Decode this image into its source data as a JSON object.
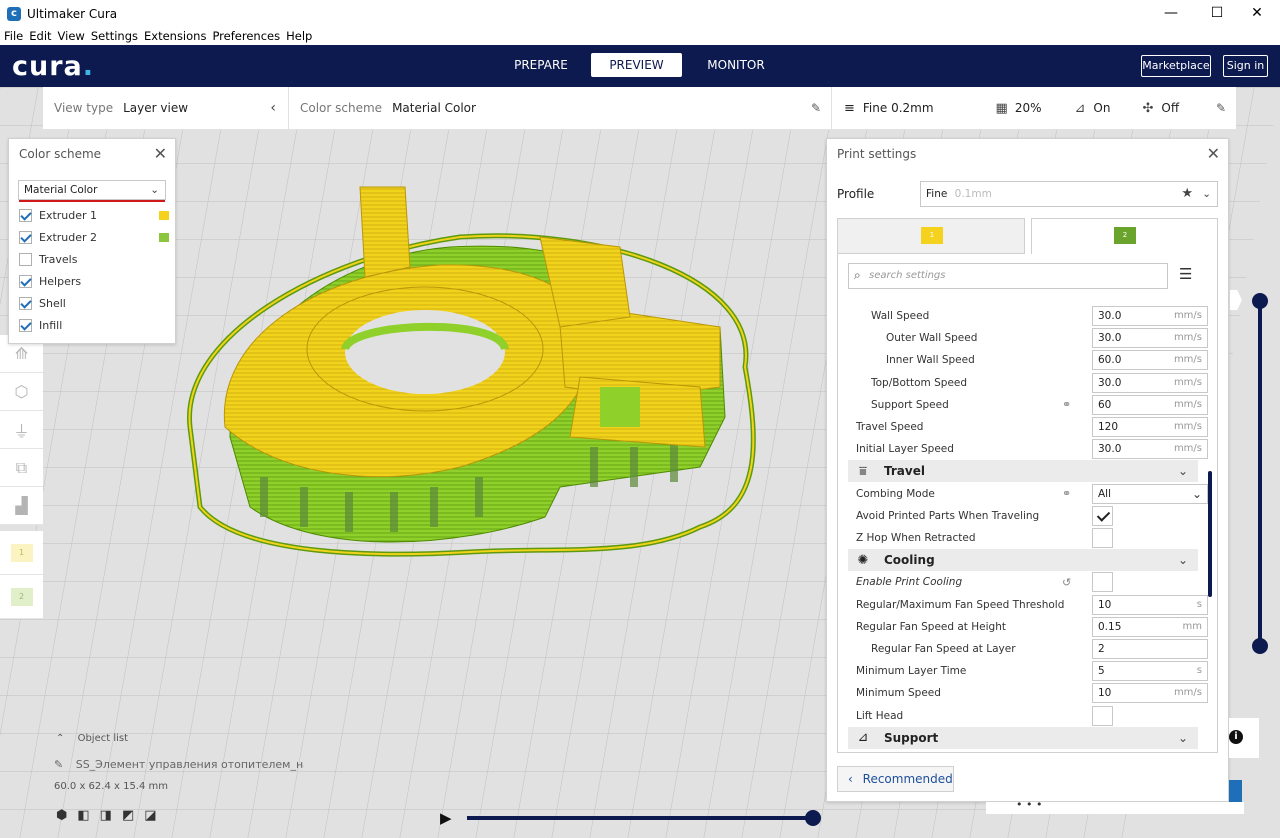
{
  "window": {
    "title": "Ultimaker Cura",
    "minimize": "—",
    "maximize": "☐",
    "close": "✕"
  },
  "menu": [
    "File",
    "Edit",
    "View",
    "Settings",
    "Extensions",
    "Preferences",
    "Help"
  ],
  "header": {
    "brand": "cura",
    "tabs": [
      {
        "label": "PREPARE"
      },
      {
        "label": "PREVIEW",
        "active": true
      },
      {
        "label": "MONITOR"
      }
    ],
    "marketplace": "Marketplace",
    "signin": "Sign in"
  },
  "stage": {
    "view_type_label": "View type",
    "view_type_value": "Layer view",
    "color_scheme_label": "Color scheme",
    "color_scheme_value": "Material Color",
    "profile": "Fine 0.2mm",
    "infill": "20%",
    "support": "On",
    "adhesion": "Off"
  },
  "color_scheme_panel": {
    "title": "Color scheme",
    "dropdown": "Material Color",
    "items": [
      {
        "label": "Extruder 1",
        "checked": true,
        "swatch": "#f5d21e"
      },
      {
        "label": "Extruder 2",
        "checked": true,
        "swatch": "#8cc63f"
      },
      {
        "label": "Travels",
        "checked": false
      },
      {
        "label": "Helpers",
        "checked": true
      },
      {
        "label": "Shell",
        "checked": true
      },
      {
        "label": "Infill",
        "checked": true
      }
    ]
  },
  "extruder_tabs": [
    "1",
    "2"
  ],
  "print_settings": {
    "title": "Print settings",
    "profile_label": "Profile",
    "profile_name": "Fine",
    "profile_detail": "0.1mm",
    "search_placeholder": "search settings",
    "recommended": "Recommended",
    "rows": [
      {
        "label": "Wall Speed",
        "indent": 1,
        "value": "30.0",
        "unit": "mm/s"
      },
      {
        "label": "Outer Wall Speed",
        "indent": 2,
        "value": "30.0",
        "unit": "mm/s"
      },
      {
        "label": "Inner Wall Speed",
        "indent": 2,
        "value": "60.0",
        "unit": "mm/s"
      },
      {
        "label": "Top/Bottom Speed",
        "indent": 1,
        "value": "30.0",
        "unit": "mm/s"
      },
      {
        "label": "Support Speed",
        "indent": 1,
        "value": "60",
        "unit": "mm/s",
        "link": true
      },
      {
        "label": "Travel Speed",
        "indent": 0,
        "value": "120",
        "unit": "mm/s"
      },
      {
        "label": "Initial Layer Speed",
        "indent": 0,
        "value": "30.0",
        "unit": "mm/s"
      },
      {
        "category": "Travel",
        "icon": "travel-icon"
      },
      {
        "label": "Combing Mode",
        "indent": 0,
        "value": "All",
        "dropdown": true,
        "link": true
      },
      {
        "label": "Avoid Printed Parts When Traveling",
        "indent": 0,
        "check": true
      },
      {
        "label": "Z Hop When Retracted",
        "indent": 0,
        "check": false
      },
      {
        "category": "Cooling",
        "icon": "fan-icon"
      },
      {
        "label": "Enable Print Cooling",
        "indent": 0,
        "check": false,
        "italic": true,
        "reset": true
      },
      {
        "label": "Regular/Maximum Fan Speed Threshold",
        "indent": 0,
        "value": "10",
        "unit": "s"
      },
      {
        "label": "Regular Fan Speed at Height",
        "indent": 0,
        "value": "0.15",
        "unit": "mm"
      },
      {
        "label": "Regular Fan Speed at Layer",
        "indent": 1,
        "value": "2",
        "unit": ""
      },
      {
        "label": "Minimum Layer Time",
        "indent": 0,
        "value": "5",
        "unit": "s"
      },
      {
        "label": "Minimum Speed",
        "indent": 0,
        "value": "10",
        "unit": "mm/s"
      },
      {
        "label": "Lift Head",
        "indent": 0,
        "check": false
      },
      {
        "category": "Support",
        "icon": "support-icon"
      }
    ]
  },
  "object_list": {
    "title": "Object list",
    "name": "SS_Элемент управления отопителем_на печать",
    "dims": "60.0 x 62.4 x 15.4 mm"
  },
  "colors": {
    "navy": "#0d1a4f",
    "accent": "#1e6fb8",
    "yellow": "#f5d21e",
    "green": "#8cc63f"
  }
}
